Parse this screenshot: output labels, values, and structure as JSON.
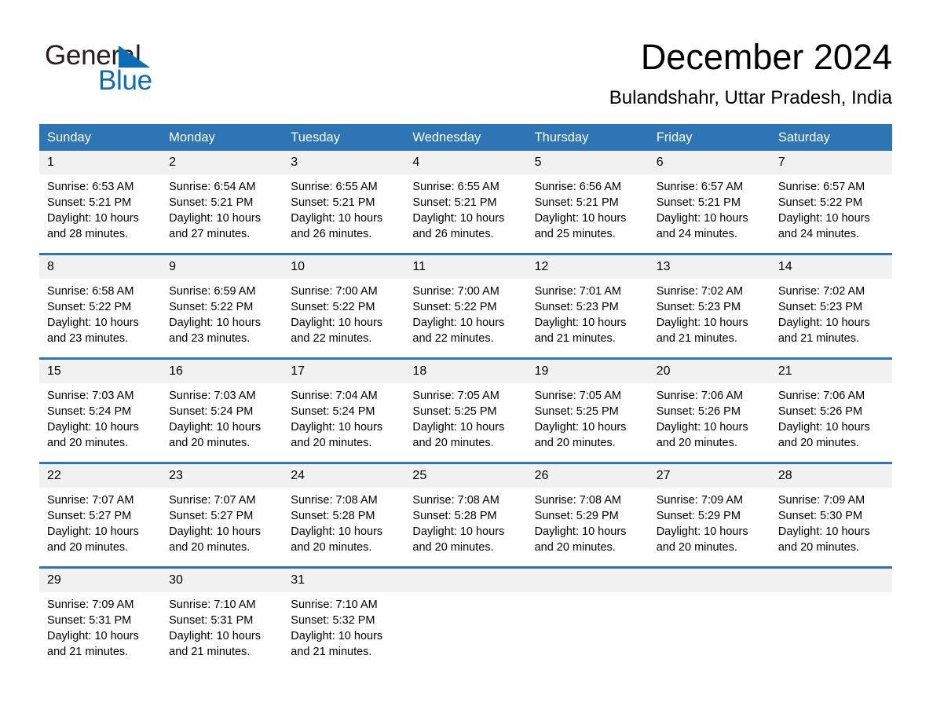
{
  "brand": {
    "word1": "General",
    "word2": "Blue",
    "triangle_color": "#0b6cb7",
    "text_color": "#231f20"
  },
  "header": {
    "title": "December 2024",
    "location": "Bulandshahr, Uttar Pradesh, India"
  },
  "theme": {
    "header_blue": "#2e75b6",
    "day_band_gray": "#f1f1f1",
    "page_background": "#ffffff"
  },
  "weekdays": [
    "Sunday",
    "Monday",
    "Tuesday",
    "Wednesday",
    "Thursday",
    "Friday",
    "Saturday"
  ],
  "weeks": [
    [
      {
        "day": "1",
        "sunrise": "Sunrise: 6:53 AM",
        "sunset": "Sunset: 5:21 PM",
        "daylight_line1": "Daylight: 10 hours",
        "daylight_line2": "and 28 minutes."
      },
      {
        "day": "2",
        "sunrise": "Sunrise: 6:54 AM",
        "sunset": "Sunset: 5:21 PM",
        "daylight_line1": "Daylight: 10 hours",
        "daylight_line2": "and 27 minutes."
      },
      {
        "day": "3",
        "sunrise": "Sunrise: 6:55 AM",
        "sunset": "Sunset: 5:21 PM",
        "daylight_line1": "Daylight: 10 hours",
        "daylight_line2": "and 26 minutes."
      },
      {
        "day": "4",
        "sunrise": "Sunrise: 6:55 AM",
        "sunset": "Sunset: 5:21 PM",
        "daylight_line1": "Daylight: 10 hours",
        "daylight_line2": "and 26 minutes."
      },
      {
        "day": "5",
        "sunrise": "Sunrise: 6:56 AM",
        "sunset": "Sunset: 5:21 PM",
        "daylight_line1": "Daylight: 10 hours",
        "daylight_line2": "and 25 minutes."
      },
      {
        "day": "6",
        "sunrise": "Sunrise: 6:57 AM",
        "sunset": "Sunset: 5:21 PM",
        "daylight_line1": "Daylight: 10 hours",
        "daylight_line2": "and 24 minutes."
      },
      {
        "day": "7",
        "sunrise": "Sunrise: 6:57 AM",
        "sunset": "Sunset: 5:22 PM",
        "daylight_line1": "Daylight: 10 hours",
        "daylight_line2": "and 24 minutes."
      }
    ],
    [
      {
        "day": "8",
        "sunrise": "Sunrise: 6:58 AM",
        "sunset": "Sunset: 5:22 PM",
        "daylight_line1": "Daylight: 10 hours",
        "daylight_line2": "and 23 minutes."
      },
      {
        "day": "9",
        "sunrise": "Sunrise: 6:59 AM",
        "sunset": "Sunset: 5:22 PM",
        "daylight_line1": "Daylight: 10 hours",
        "daylight_line2": "and 23 minutes."
      },
      {
        "day": "10",
        "sunrise": "Sunrise: 7:00 AM",
        "sunset": "Sunset: 5:22 PM",
        "daylight_line1": "Daylight: 10 hours",
        "daylight_line2": "and 22 minutes."
      },
      {
        "day": "11",
        "sunrise": "Sunrise: 7:00 AM",
        "sunset": "Sunset: 5:22 PM",
        "daylight_line1": "Daylight: 10 hours",
        "daylight_line2": "and 22 minutes."
      },
      {
        "day": "12",
        "sunrise": "Sunrise: 7:01 AM",
        "sunset": "Sunset: 5:23 PM",
        "daylight_line1": "Daylight: 10 hours",
        "daylight_line2": "and 21 minutes."
      },
      {
        "day": "13",
        "sunrise": "Sunrise: 7:02 AM",
        "sunset": "Sunset: 5:23 PM",
        "daylight_line1": "Daylight: 10 hours",
        "daylight_line2": "and 21 minutes."
      },
      {
        "day": "14",
        "sunrise": "Sunrise: 7:02 AM",
        "sunset": "Sunset: 5:23 PM",
        "daylight_line1": "Daylight: 10 hours",
        "daylight_line2": "and 21 minutes."
      }
    ],
    [
      {
        "day": "15",
        "sunrise": "Sunrise: 7:03 AM",
        "sunset": "Sunset: 5:24 PM",
        "daylight_line1": "Daylight: 10 hours",
        "daylight_line2": "and 20 minutes."
      },
      {
        "day": "16",
        "sunrise": "Sunrise: 7:03 AM",
        "sunset": "Sunset: 5:24 PM",
        "daylight_line1": "Daylight: 10 hours",
        "daylight_line2": "and 20 minutes."
      },
      {
        "day": "17",
        "sunrise": "Sunrise: 7:04 AM",
        "sunset": "Sunset: 5:24 PM",
        "daylight_line1": "Daylight: 10 hours",
        "daylight_line2": "and 20 minutes."
      },
      {
        "day": "18",
        "sunrise": "Sunrise: 7:05 AM",
        "sunset": "Sunset: 5:25 PM",
        "daylight_line1": "Daylight: 10 hours",
        "daylight_line2": "and 20 minutes."
      },
      {
        "day": "19",
        "sunrise": "Sunrise: 7:05 AM",
        "sunset": "Sunset: 5:25 PM",
        "daylight_line1": "Daylight: 10 hours",
        "daylight_line2": "and 20 minutes."
      },
      {
        "day": "20",
        "sunrise": "Sunrise: 7:06 AM",
        "sunset": "Sunset: 5:26 PM",
        "daylight_line1": "Daylight: 10 hours",
        "daylight_line2": "and 20 minutes."
      },
      {
        "day": "21",
        "sunrise": "Sunrise: 7:06 AM",
        "sunset": "Sunset: 5:26 PM",
        "daylight_line1": "Daylight: 10 hours",
        "daylight_line2": "and 20 minutes."
      }
    ],
    [
      {
        "day": "22",
        "sunrise": "Sunrise: 7:07 AM",
        "sunset": "Sunset: 5:27 PM",
        "daylight_line1": "Daylight: 10 hours",
        "daylight_line2": "and 20 minutes."
      },
      {
        "day": "23",
        "sunrise": "Sunrise: 7:07 AM",
        "sunset": "Sunset: 5:27 PM",
        "daylight_line1": "Daylight: 10 hours",
        "daylight_line2": "and 20 minutes."
      },
      {
        "day": "24",
        "sunrise": "Sunrise: 7:08 AM",
        "sunset": "Sunset: 5:28 PM",
        "daylight_line1": "Daylight: 10 hours",
        "daylight_line2": "and 20 minutes."
      },
      {
        "day": "25",
        "sunrise": "Sunrise: 7:08 AM",
        "sunset": "Sunset: 5:28 PM",
        "daylight_line1": "Daylight: 10 hours",
        "daylight_line2": "and 20 minutes."
      },
      {
        "day": "26",
        "sunrise": "Sunrise: 7:08 AM",
        "sunset": "Sunset: 5:29 PM",
        "daylight_line1": "Daylight: 10 hours",
        "daylight_line2": "and 20 minutes."
      },
      {
        "day": "27",
        "sunrise": "Sunrise: 7:09 AM",
        "sunset": "Sunset: 5:29 PM",
        "daylight_line1": "Daylight: 10 hours",
        "daylight_line2": "and 20 minutes."
      },
      {
        "day": "28",
        "sunrise": "Sunrise: 7:09 AM",
        "sunset": "Sunset: 5:30 PM",
        "daylight_line1": "Daylight: 10 hours",
        "daylight_line2": "and 20 minutes."
      }
    ],
    [
      {
        "day": "29",
        "sunrise": "Sunrise: 7:09 AM",
        "sunset": "Sunset: 5:31 PM",
        "daylight_line1": "Daylight: 10 hours",
        "daylight_line2": "and 21 minutes."
      },
      {
        "day": "30",
        "sunrise": "Sunrise: 7:10 AM",
        "sunset": "Sunset: 5:31 PM",
        "daylight_line1": "Daylight: 10 hours",
        "daylight_line2": "and 21 minutes."
      },
      {
        "day": "31",
        "sunrise": "Sunrise: 7:10 AM",
        "sunset": "Sunset: 5:32 PM",
        "daylight_line1": "Daylight: 10 hours",
        "daylight_line2": "and 21 minutes."
      },
      {
        "day": "",
        "sunrise": "",
        "sunset": "",
        "daylight_line1": "",
        "daylight_line2": ""
      },
      {
        "day": "",
        "sunrise": "",
        "sunset": "",
        "daylight_line1": "",
        "daylight_line2": ""
      },
      {
        "day": "",
        "sunrise": "",
        "sunset": "",
        "daylight_line1": "",
        "daylight_line2": ""
      },
      {
        "day": "",
        "sunrise": "",
        "sunset": "",
        "daylight_line1": "",
        "daylight_line2": ""
      }
    ]
  ]
}
